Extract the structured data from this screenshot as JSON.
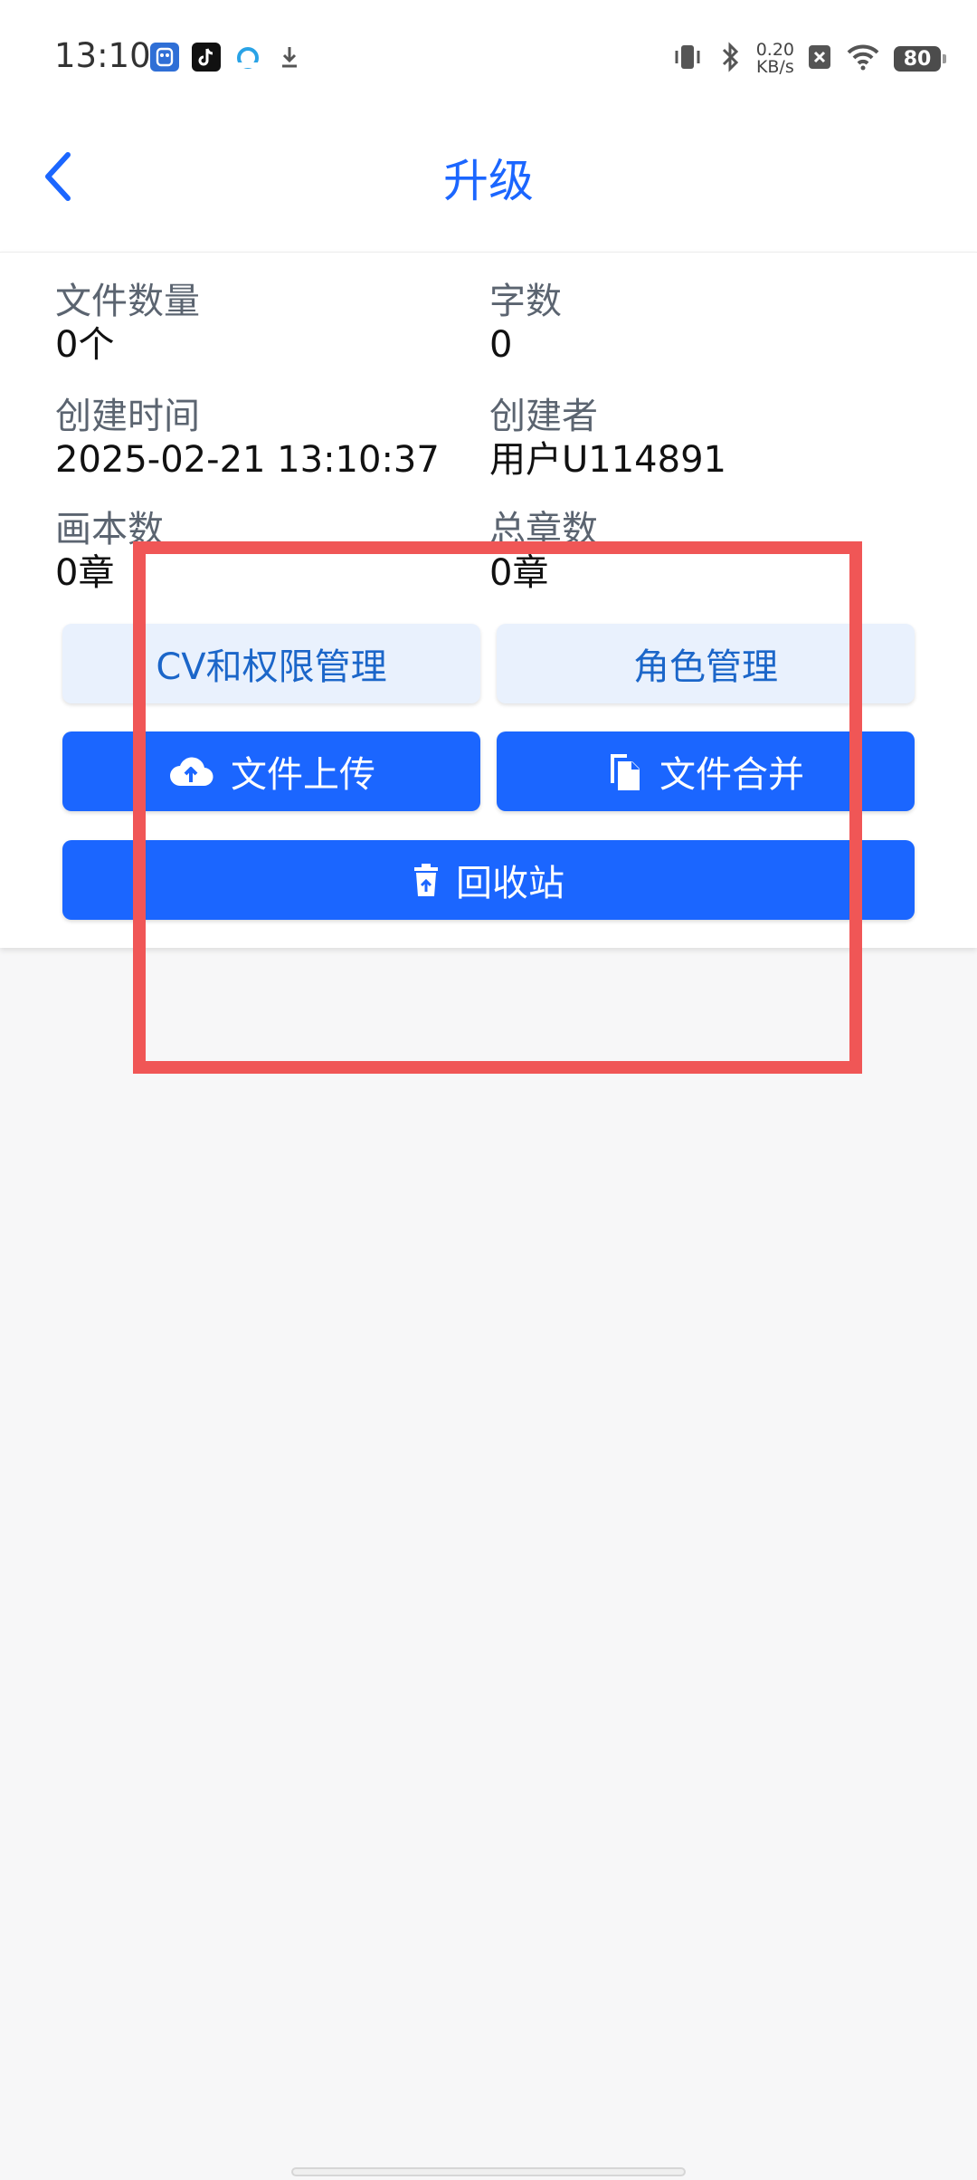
{
  "status_bar": {
    "time": "13:10",
    "apps": [
      "app-icon",
      "tiktok-icon",
      "cloud-app-icon",
      "download-icon"
    ],
    "net_speed_value": "0.20",
    "net_speed_unit": "KB/s",
    "battery": "80"
  },
  "header": {
    "title": "升级"
  },
  "stats": {
    "file_count_label": "文件数量",
    "file_count_value": "0个",
    "word_count_label": "字数",
    "word_count_value": "0",
    "created_time_label": "创建时间",
    "created_time_value": "2025-02-21 13:10:37",
    "creator_label": "创建者",
    "creator_value": "用户U114891",
    "picture_count_label": "画本数",
    "picture_count_value": "0章",
    "total_chapters_label": "总章数",
    "total_chapters_value": "0章"
  },
  "actions": {
    "cv_permissions": "CV和权限管理",
    "role_management": "角色管理",
    "file_upload": "文件上传",
    "file_merge": "文件合并",
    "recycle_bin": "回收站"
  },
  "colors": {
    "accent": "#1b66ff",
    "light_button_bg": "#e9f1fd",
    "highlight": "#f05656"
  }
}
